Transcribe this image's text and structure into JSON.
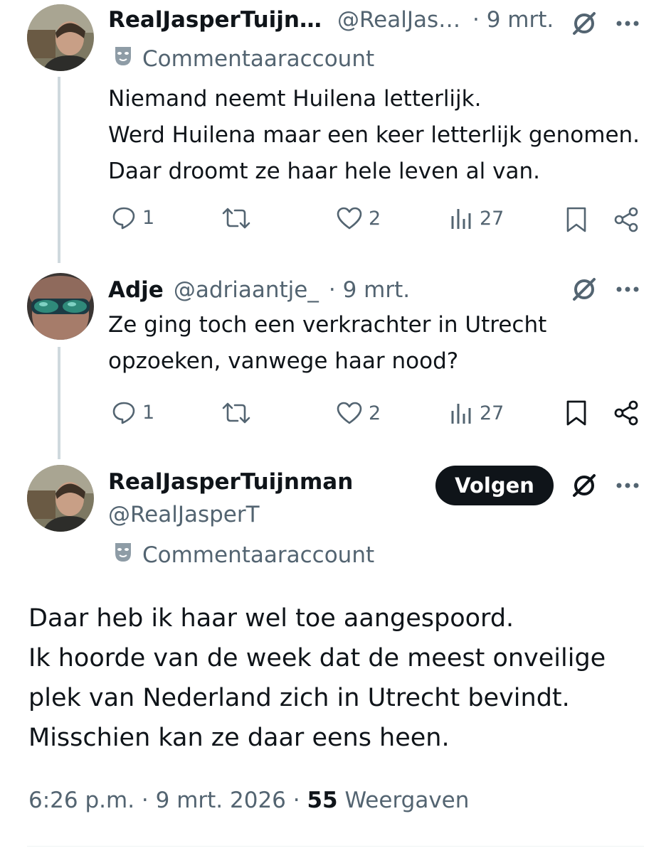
{
  "tweets": [
    {
      "author": "RealJasperTuijn…",
      "handle": "@RealJas…",
      "date": "· 9 mrt.",
      "badge": "Commentaaraccount",
      "lines": [
        "Niemand neemt Huilena letterlijk.",
        "Werd Huilena maar een keer letterlijk genomen.",
        "Daar droomt ze haar hele leven al van."
      ],
      "replies": "1",
      "likes": "2",
      "views": "27"
    },
    {
      "author": "Adje",
      "handle": "@adriaantje_",
      "date": "· 9 mrt.",
      "lines": [
        "Ze ging toch een verkrachter in Utrecht",
        "opzoeken, vanwege haar nood?"
      ],
      "replies": "1",
      "likes": "2",
      "views": "27"
    }
  ],
  "main_tweet": {
    "author": "RealJasperTuijnman",
    "handle": "@RealJasperT",
    "badge": "Commentaaraccount",
    "follow_label": "Volgen",
    "lines": [
      "Daar heb ik haar wel toe aangespoord.",
      "Ik hoorde van de week dat de meest onveilige",
      "plek van Nederland zich in Utrecht bevindt.",
      "Misschien kan ze daar eens heen."
    ],
    "time": "6:26 p.m. · 9 mrt. 2026 ·",
    "views_count": "55",
    "views_label": "Weergaven"
  },
  "icons": {
    "more": "more-icon",
    "grok": "grok-icon",
    "reply": "reply-icon",
    "retweet": "retweet-icon",
    "like": "like-icon",
    "views": "views-icon",
    "bookmark": "bookmark-icon",
    "share": "share-icon",
    "mask": "mask-icon"
  },
  "colors": {
    "text": "#0f1419",
    "muted": "#536471",
    "thread": "#cfd9de",
    "follow_bg": "#0f1419"
  }
}
